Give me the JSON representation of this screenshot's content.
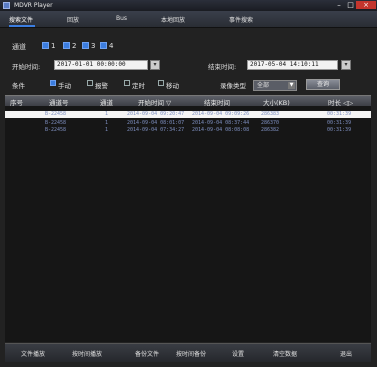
{
  "window": {
    "title": "MDVR Player"
  },
  "menu": {
    "items": [
      "搜索文件",
      "回放",
      "Bus",
      "本地回放",
      "事件搜索"
    ]
  },
  "channels": {
    "label": "通道",
    "items": [
      "1",
      "2",
      "3",
      "4"
    ]
  },
  "time": {
    "start_label": "开始时间:",
    "start_value": "2017-01-01 00:00:00",
    "end_label": "结束时间:",
    "end_value": "2017-05-04 14:10:11"
  },
  "filter": {
    "label": "条件",
    "options": [
      {
        "label": "手动",
        "selected": true
      },
      {
        "label": "报警",
        "selected": false
      },
      {
        "label": "定时",
        "selected": false
      },
      {
        "label": "移动",
        "selected": false
      }
    ],
    "type_label": "录像类型",
    "type_value": "全部",
    "query_button": "查询"
  },
  "table": {
    "columns": [
      "序号",
      "通道号",
      "通道",
      "开始时间 ▽",
      "结束时间",
      "大小(KB)",
      "时长 ◁▷"
    ],
    "rows": [
      {
        "plate": "B-22458",
        "ch": "1",
        "start": "2014-09-04 09:20:47",
        "end": "2014-09-04 09:09:26",
        "size": "286383",
        "dur": "00:31:39",
        "selected": true
      },
      {
        "plate": "B-22458",
        "ch": "1",
        "start": "2014-09-04 08:01:07",
        "end": "2014-09-04 08:37:44",
        "size": "286370",
        "dur": "00:31:39",
        "selected": false
      },
      {
        "plate": "B-22458",
        "ch": "1",
        "start": "2014-09-04 07:34:27",
        "end": "2014-09-04 08:08:08",
        "size": "286382",
        "dur": "00:31:39",
        "selected": false
      }
    ]
  },
  "bottom": {
    "buttons": [
      "文件播放",
      "按时间播放",
      "备份文件",
      "按时间备份",
      "设置",
      "清空数据",
      "退出"
    ]
  },
  "colors": {
    "accent": "#3b7de0",
    "close": "#c4352d"
  }
}
